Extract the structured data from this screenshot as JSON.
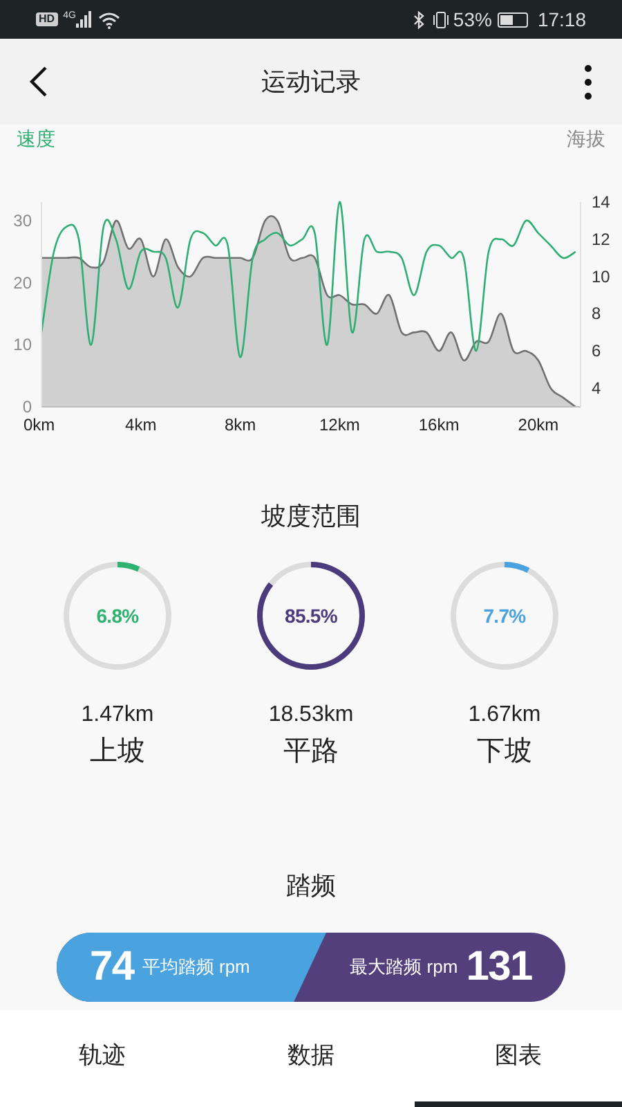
{
  "status_bar": {
    "badge": "HD",
    "network": "4G",
    "battery": "53%",
    "time": "17:18"
  },
  "header": {
    "title": "运动记录"
  },
  "chart_data": {
    "type": "line",
    "x": [
      0,
      0.5,
      1,
      1.5,
      2,
      2.5,
      3,
      3.5,
      4,
      4.5,
      5,
      5.5,
      6,
      6.5,
      7,
      7.5,
      8,
      8.5,
      9,
      9.5,
      10,
      10.5,
      11,
      11.5,
      12,
      12.5,
      13,
      13.5,
      14,
      14.5,
      15,
      15.5,
      16,
      16.5,
      17,
      17.5,
      18,
      18.5,
      19,
      19.5,
      20,
      20.5,
      21,
      21.5
    ],
    "series": [
      {
        "name": "速度",
        "color": "#2fae74",
        "values": [
          12,
          25,
          29,
          27,
          10,
          29,
          27,
          19,
          25,
          25,
          24,
          16,
          27,
          28,
          26,
          26,
          8,
          24,
          27,
          28,
          26,
          27,
          28,
          10,
          33,
          12,
          27,
          25,
          25,
          24,
          18,
          25,
          26,
          24,
          24,
          9,
          25,
          27,
          26,
          30,
          28,
          26,
          24,
          25
        ]
      },
      {
        "name": "海拔",
        "color": "#707070",
        "axis": "y2",
        "type": "area",
        "values": [
          11,
          11,
          11,
          11,
          10.5,
          10.8,
          13,
          11.5,
          12,
          10,
          12,
          10.5,
          10,
          11,
          11,
          11,
          11,
          11,
          13,
          13,
          11,
          11,
          11,
          9,
          9,
          8.5,
          8.5,
          8,
          9,
          7,
          7,
          7,
          6,
          7,
          5.5,
          6.5,
          6.5,
          8,
          6,
          6,
          5.5,
          4,
          3.5,
          3
        ]
      }
    ],
    "xlim": [
      0,
      21.7
    ],
    "ylim": [
      0,
      33
    ],
    "y2lim": [
      3,
      14
    ],
    "xticks": [
      {
        "value": 0,
        "label": "0km"
      },
      {
        "value": 4,
        "label": "4km"
      },
      {
        "value": 8,
        "label": "8km"
      },
      {
        "value": 12,
        "label": "12km"
      },
      {
        "value": 16,
        "label": "16km"
      },
      {
        "value": 20,
        "label": "20km"
      }
    ],
    "yticks": [
      0,
      10,
      20,
      30
    ],
    "y2ticks": [
      4,
      6,
      8,
      10,
      12,
      14
    ]
  },
  "slope": {
    "title": "坡度范围",
    "items": [
      {
        "percent": "6.8%",
        "level": 0.068,
        "color": "#2db36f",
        "distance": "1.47km",
        "label": "上坡"
      },
      {
        "percent": "85.5%",
        "level": 0.855,
        "color": "#4b3a7c",
        "distance": "18.53km",
        "label": "平路"
      },
      {
        "percent": "7.7%",
        "level": 0.077,
        "color": "#4aa2e0",
        "distance": "1.67km",
        "label": "下坡"
      }
    ]
  },
  "cadence": {
    "title": "踏频",
    "average": "74",
    "average_label": "平均踏频 rpm",
    "max_label": "最大踏频 rpm",
    "max": "131"
  },
  "tabs": [
    {
      "label": "轨迹",
      "selected": false
    },
    {
      "label": "数据",
      "selected": false
    },
    {
      "label": "图表",
      "selected": true
    }
  ]
}
